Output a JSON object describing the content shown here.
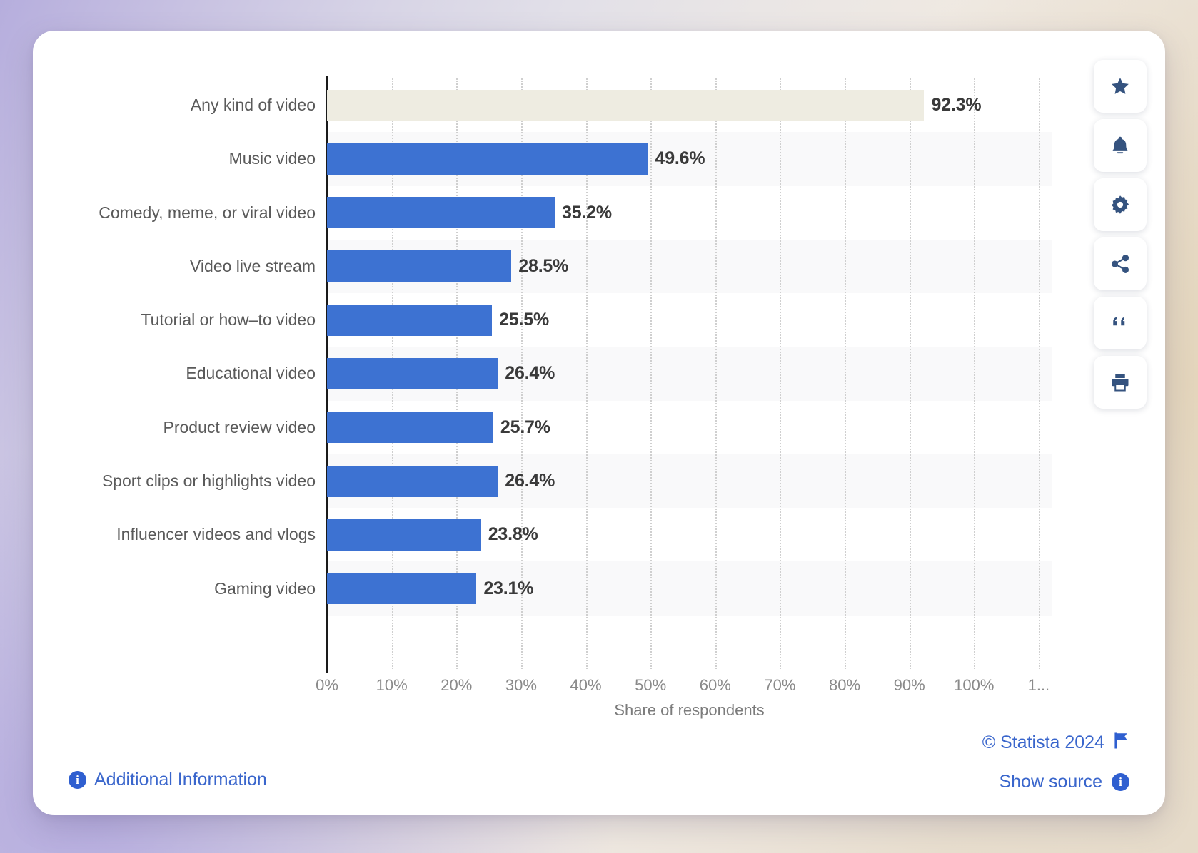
{
  "chart_data": {
    "type": "bar",
    "orientation": "horizontal",
    "title": "",
    "xlabel": "Share of respondents",
    "ylabel": "",
    "xlim": [
      0,
      112
    ],
    "grid": true,
    "legend": "none",
    "xtick_labels": [
      "0%",
      "10%",
      "20%",
      "30%",
      "40%",
      "50%",
      "60%",
      "70%",
      "80%",
      "90%",
      "100%",
      "1..."
    ],
    "xtick_values": [
      0,
      10,
      20,
      30,
      40,
      50,
      60,
      70,
      80,
      90,
      100,
      110
    ],
    "categories": [
      "Any kind of video",
      "Music video",
      "Comedy, meme, or viral video",
      "Video live stream",
      "Tutorial or how–to video",
      "Educational video",
      "Product review video",
      "Sport clips or highlights video",
      "Influencer videos and vlogs",
      "Gaming video"
    ],
    "values": [
      92.3,
      49.6,
      35.2,
      28.5,
      25.5,
      26.4,
      25.7,
      26.4,
      23.8,
      23.1
    ],
    "value_labels": [
      "92.3%",
      "49.6%",
      "35.2%",
      "28.5%",
      "25.5%",
      "26.4%",
      "25.7%",
      "26.4%",
      "23.8%",
      "23.1%"
    ],
    "bar_colors": [
      "#eeece1",
      "#3d72d2",
      "#3d72d2",
      "#3d72d2",
      "#3d72d2",
      "#3d72d2",
      "#3d72d2",
      "#3d72d2",
      "#3d72d2",
      "#3d72d2"
    ],
    "accent_color": "#3d72d2",
    "highlight_color": "#eeece1"
  },
  "toolbar": {
    "buttons": [
      {
        "name": "favorite",
        "icon": "star-icon"
      },
      {
        "name": "alert",
        "icon": "bell-icon"
      },
      {
        "name": "settings",
        "icon": "gear-icon"
      },
      {
        "name": "share",
        "icon": "share-icon"
      },
      {
        "name": "cite",
        "icon": "quote-icon"
      },
      {
        "name": "print",
        "icon": "print-icon"
      }
    ]
  },
  "footer": {
    "additional_information": "Additional Information",
    "copyright": "© Statista 2024",
    "show_source": "Show source",
    "info_glyph": "i",
    "link_color": "#3a66cc"
  }
}
